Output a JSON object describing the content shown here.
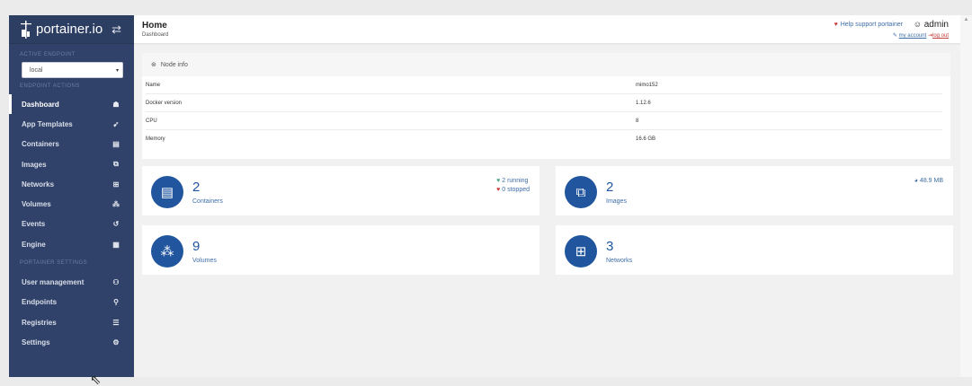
{
  "app": {
    "logo_text": "portainer.io"
  },
  "sidebar": {
    "active_endpoint_title": "ACTIVE ENDPOINT",
    "endpoint_select_value": "local",
    "endpoint_actions_title": "ENDPOINT ACTIONS",
    "portainer_settings_title": "PORTAINER SETTINGS",
    "items": [
      {
        "label": "Dashboard",
        "icon": "dashboard-icon",
        "glyph": "☗",
        "active": true
      },
      {
        "label": "App Templates",
        "icon": "rocket-icon",
        "glyph": "➹"
      },
      {
        "label": "Containers",
        "icon": "server-icon",
        "glyph": "▤"
      },
      {
        "label": "Images",
        "icon": "clone-icon",
        "glyph": "⧉"
      },
      {
        "label": "Networks",
        "icon": "sitemap-icon",
        "glyph": "⊞"
      },
      {
        "label": "Volumes",
        "icon": "cubes-icon",
        "glyph": "⁂"
      },
      {
        "label": "Events",
        "icon": "history-icon",
        "glyph": "↺"
      },
      {
        "label": "Engine",
        "icon": "th-icon",
        "glyph": "▦"
      }
    ],
    "settings_items": [
      {
        "label": "User management",
        "icon": "users-icon",
        "glyph": "⚇"
      },
      {
        "label": "Endpoints",
        "icon": "plug-icon",
        "glyph": "⚲"
      },
      {
        "label": "Registries",
        "icon": "database-icon",
        "glyph": "☰"
      },
      {
        "label": "Settings",
        "icon": "cogs-icon",
        "glyph": "⚙"
      }
    ]
  },
  "header": {
    "title": "Home",
    "breadcrumb": "Dashboard",
    "help_text": "Help support portainer",
    "username": "admin",
    "my_account": "my account",
    "log_out": "log out"
  },
  "node_info": {
    "title": "Node info",
    "rows": [
      {
        "key": "Name",
        "value": "mimo152"
      },
      {
        "key": "Docker version",
        "value": "1.12.6"
      },
      {
        "key": "CPU",
        "value": "8"
      },
      {
        "key": "Memory",
        "value": "16.6 GB"
      }
    ]
  },
  "stats": {
    "containers": {
      "count": "2",
      "label": "Containers",
      "running": "2 running",
      "stopped": "0 stopped"
    },
    "images": {
      "count": "2",
      "label": "Images",
      "size": "48.9 MB"
    },
    "volumes": {
      "count": "9",
      "label": "Volumes"
    },
    "networks": {
      "count": "3",
      "label": "Networks"
    }
  }
}
